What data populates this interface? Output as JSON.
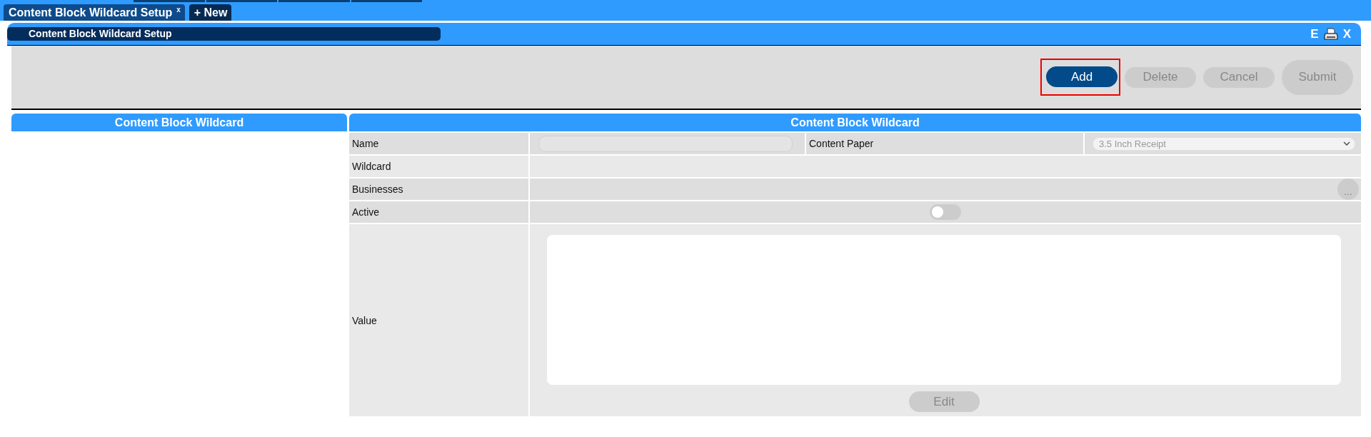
{
  "tabs": [
    {
      "label": "Content Block Wildcard Setup",
      "close": "x",
      "selected": true
    },
    {
      "label": "+ New",
      "selected": false
    }
  ],
  "window": {
    "title": "Content Block Wildcard Setup",
    "export": "E",
    "close": "X"
  },
  "toolbar": {
    "buttons": [
      {
        "label": "Add",
        "kind": "action",
        "disabled": false,
        "highlighted": true
      },
      {
        "label": "Delete",
        "kind": "action",
        "disabled": true,
        "highlighted": false
      },
      {
        "label": "Cancel",
        "kind": "action",
        "disabled": true,
        "highlighted": false
      },
      {
        "label": "Submit",
        "kind": "submit",
        "disabled": true,
        "highlighted": false
      }
    ]
  },
  "list_panel": {
    "title": "Content Block Wildcard"
  },
  "form": {
    "title": "Content Block Wildcard",
    "rows": [
      {
        "kind": "combo",
        "label": "Name",
        "field": {
          "disabled": true
        },
        "second_label": "Content Paper",
        "select": {
          "value": "3.5 Inch Receipt",
          "disabled": true
        }
      },
      {
        "kind": "plain",
        "label": "Wildcard"
      },
      {
        "kind": "picker",
        "label": "Businesses",
        "button": "..."
      },
      {
        "kind": "toggle",
        "label": "Active",
        "on": false
      },
      {
        "kind": "editor",
        "label": "Value",
        "button": {
          "label": "Edit",
          "disabled": true
        }
      }
    ]
  }
}
